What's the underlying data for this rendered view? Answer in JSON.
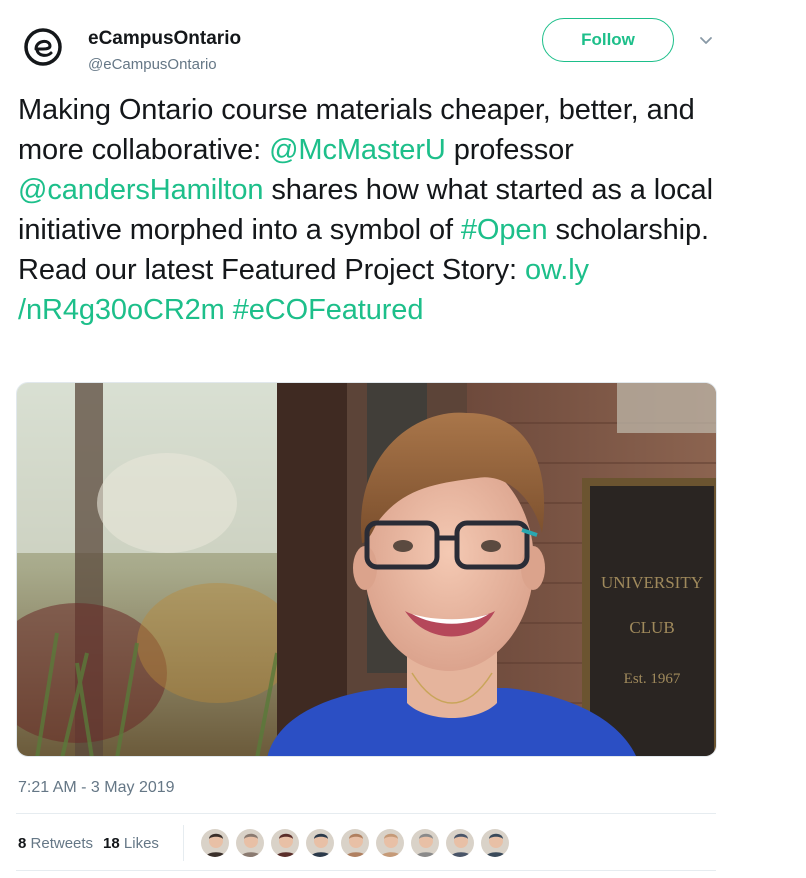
{
  "author": {
    "name": "eCampusOntario",
    "handle": "@eCampusOntario",
    "avatar_icon": "ecampus-logo-icon"
  },
  "follow_label": "Follow",
  "caret_icon": "chevron-down-icon",
  "tweet": {
    "t1": "Making Ontario course materials cheaper, better, and more collaborative: ",
    "mention1": "@McMasterU",
    "t2": " professor ",
    "mention2": "@candersHamilton",
    "t3": " shares how what started as a local initiative morphed into a symbol of ",
    "hashtag1": "#Open",
    "t4": " scholarship. Read our latest Featured Project Story: ",
    "link": "ow.ly\n/nR4g30oCR2m",
    "t5": " ",
    "hashtag2": "#eCOFeatured"
  },
  "photo_sign": {
    "line1": "UNIVERSITY",
    "line2": "CLUB",
    "line3": "Est. 1967"
  },
  "timestamp": "7:21 AM - 3 May 2019",
  "stats": {
    "retweets_count": "8",
    "retweets_label": "Retweets",
    "likes_count": "18",
    "likes_label": "Likes"
  },
  "likers": [
    "#3a2f2a",
    "#8a7a70",
    "#5a2e2a",
    "#2c3a4a",
    "#b08060",
    "#c59a78",
    "#8a8a8a",
    "#4a5568",
    "#3a4a5a"
  ],
  "colors": {
    "accent": "#1dbf8a",
    "text": "#14171a",
    "muted": "#657786"
  }
}
